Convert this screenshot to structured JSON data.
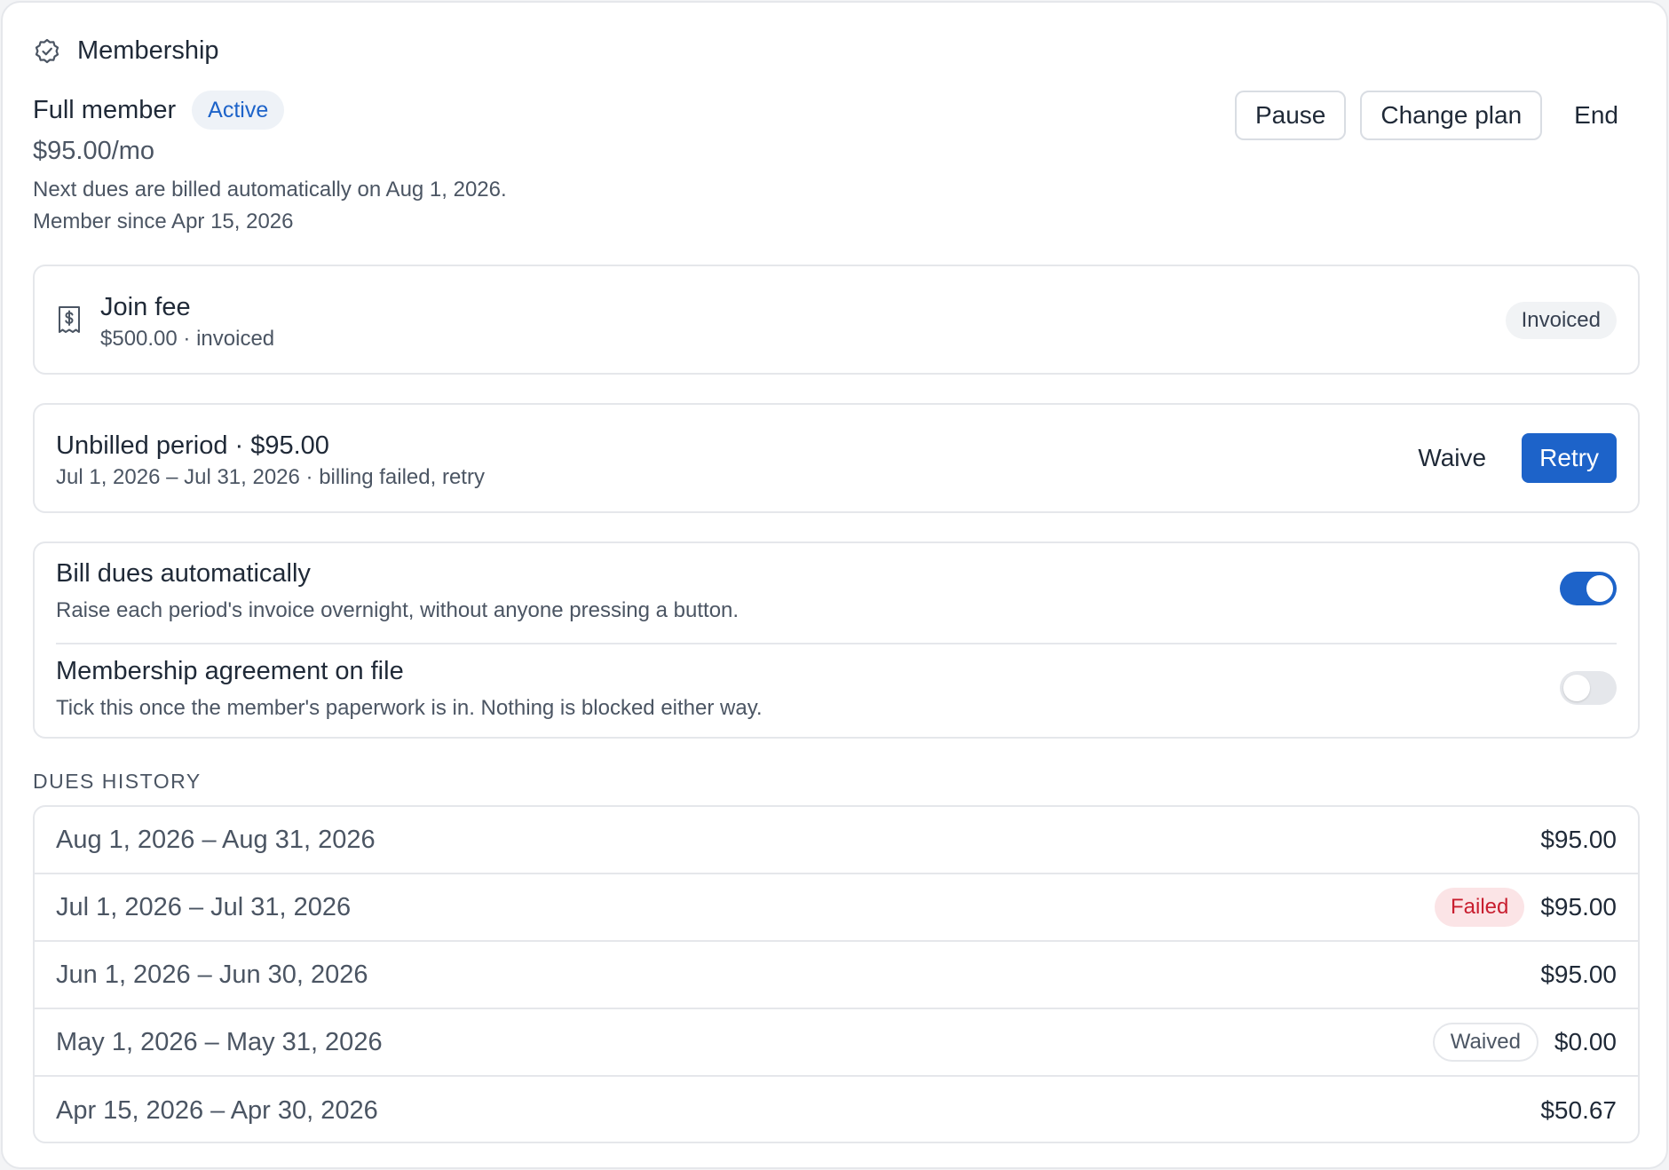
{
  "header": {
    "title": "Membership",
    "icon": "badge-check-icon"
  },
  "plan": {
    "name": "Full member",
    "status": "Active",
    "price": "$95.00/mo",
    "next_billing": "Next dues are billed automatically on Aug 1, 2026.",
    "member_since": "Member since Apr 15, 2026"
  },
  "actions": {
    "pause": "Pause",
    "change_plan": "Change plan",
    "end": "End"
  },
  "join_fee": {
    "title": "Join fee",
    "subtitle": "$500.00 · invoiced",
    "badge": "Invoiced",
    "icon": "receipt-dollar-icon"
  },
  "unbilled": {
    "title": "Unbilled period · $95.00",
    "subtitle": "Jul 1, 2026 – Jul 31, 2026 · billing failed, retry",
    "waive": "Waive",
    "retry": "Retry"
  },
  "settings": [
    {
      "title": "Bill dues automatically",
      "description": "Raise each period's invoice overnight, without anyone pressing a button.",
      "enabled": true
    },
    {
      "title": "Membership agreement on file",
      "description": "Tick this once the member's paperwork is in. Nothing is blocked either way.",
      "enabled": false
    }
  ],
  "history": {
    "label": "DUES HISTORY",
    "rows": [
      {
        "period": "Aug 1, 2026 – Aug 31, 2026",
        "amount": "$95.00",
        "badge": ""
      },
      {
        "period": "Jul 1, 2026 – Jul 31, 2026",
        "amount": "$95.00",
        "badge": "Failed"
      },
      {
        "period": "Jun 1, 2026 – Jun 30, 2026",
        "amount": "$95.00",
        "badge": ""
      },
      {
        "period": "May 1, 2026 – May 31, 2026",
        "amount": "$0.00",
        "badge": "Waived"
      },
      {
        "period": "Apr 15, 2026 – Apr 30, 2026",
        "amount": "$50.67",
        "badge": ""
      }
    ]
  },
  "colors": {
    "accent": "#1d63c9",
    "failed_bg": "#fbe4e6",
    "failed_text": "#c81e2f",
    "border": "#e5e7eb"
  }
}
